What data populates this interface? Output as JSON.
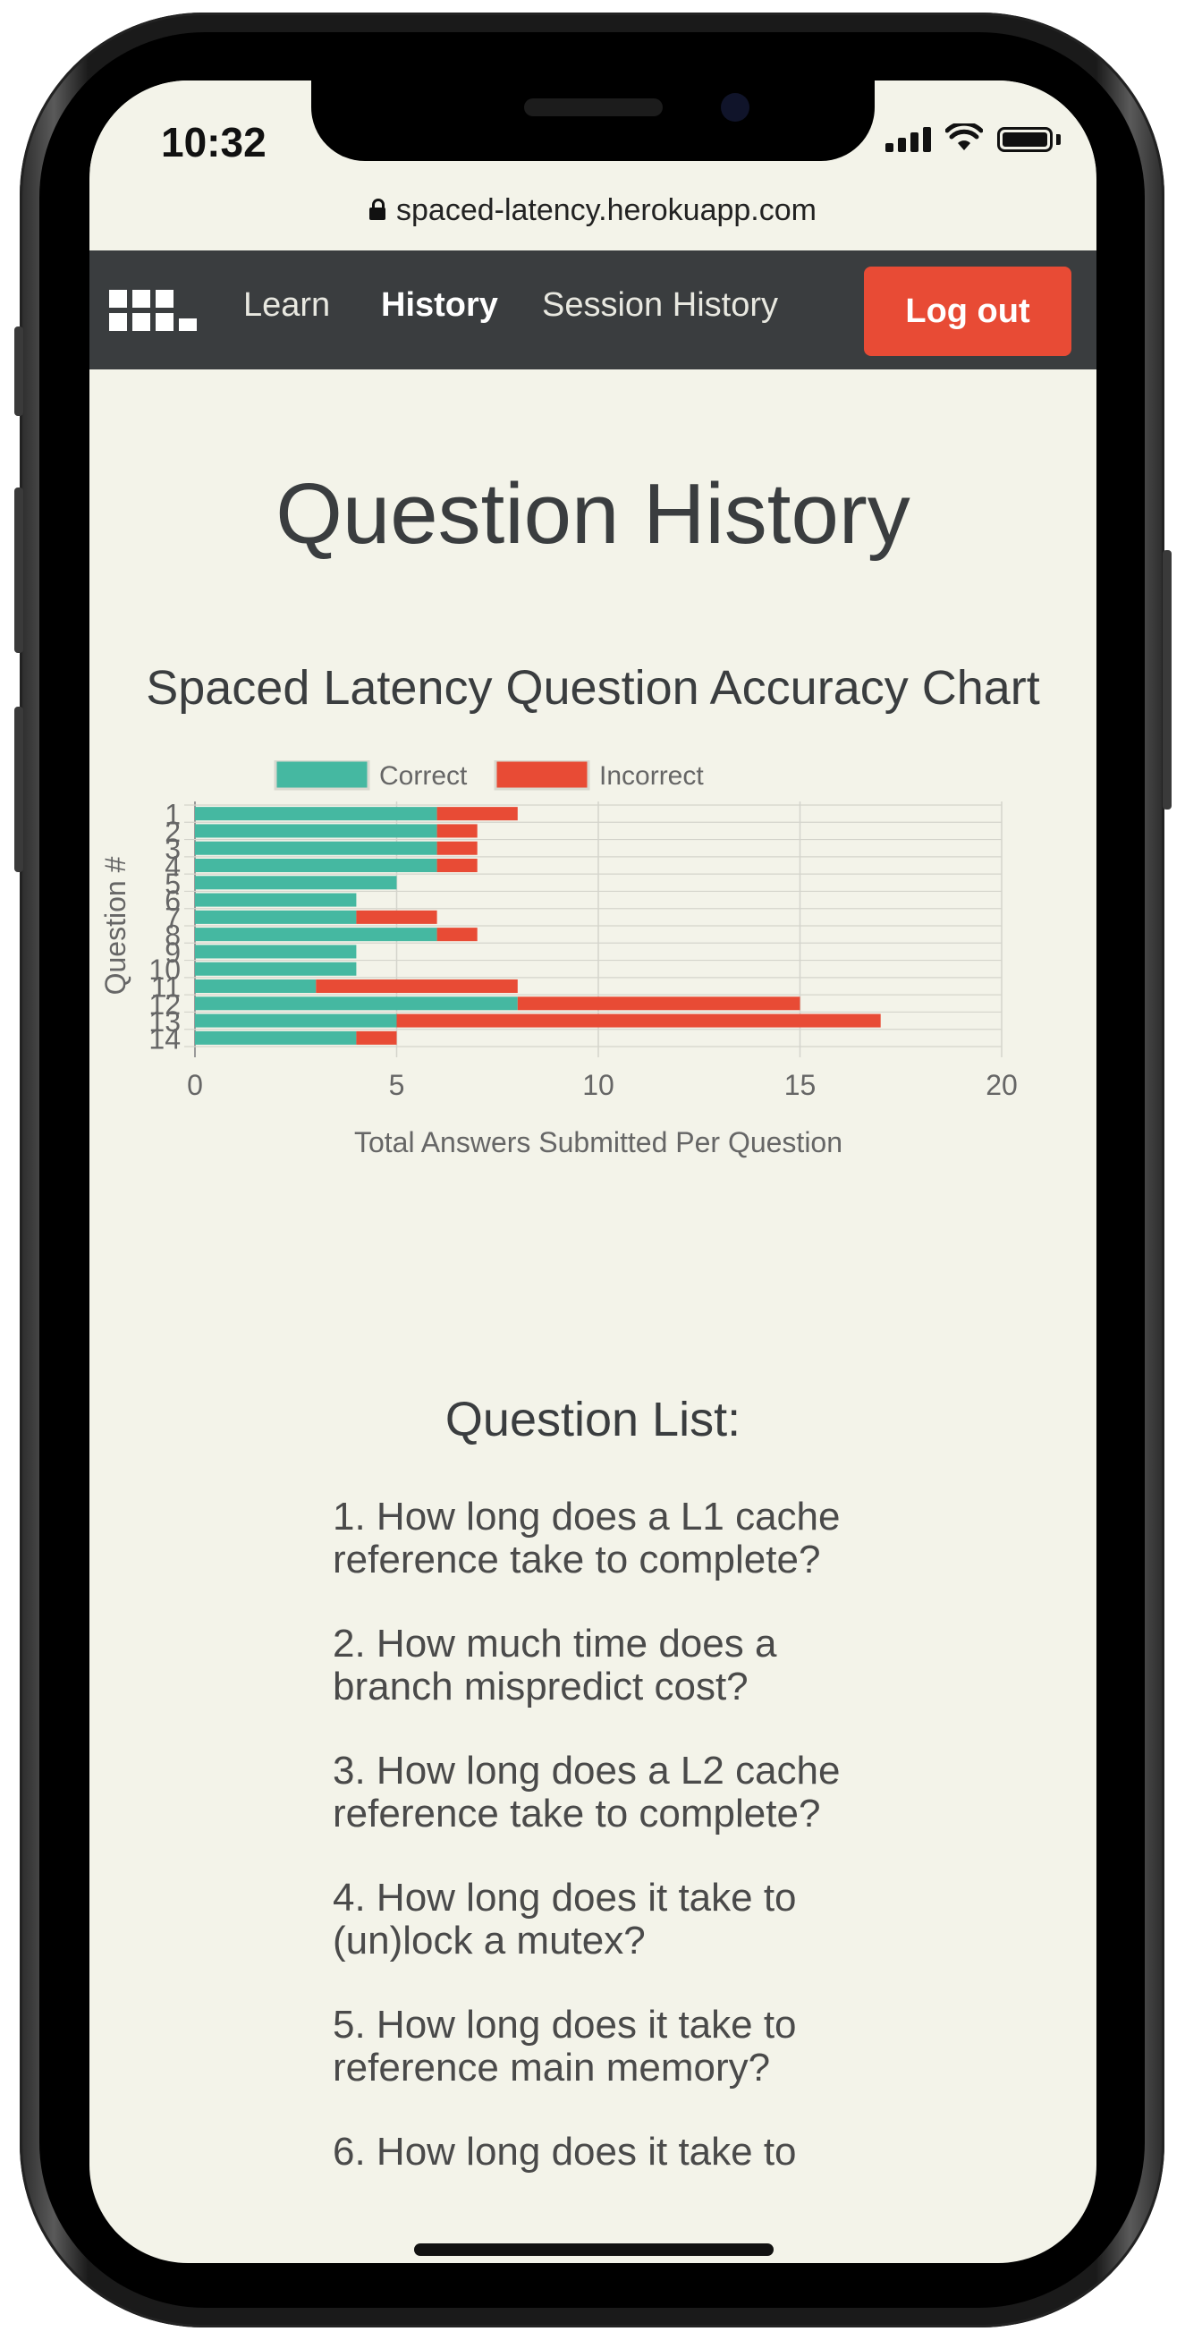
{
  "status_bar": {
    "time": "10:32"
  },
  "browser": {
    "url": "spaced-latency.herokuapp.com"
  },
  "nav": {
    "items": [
      "Learn",
      "History",
      "Session History"
    ],
    "active": "History",
    "logout_label": "Log out"
  },
  "page": {
    "title": "Question History",
    "chart_title": "Spaced Latency Question Accuracy Chart",
    "list_title": "Question List:"
  },
  "questions": [
    "1. How long does a L1 cache reference take to complete?",
    "2. How much time does a branch mispredict cost?",
    "3. How long does a L2 cache reference take to complete?",
    "4. How long does it take to (un)lock a mutex?",
    "5. How long does it take to reference main memory?",
    "6. How long does it take to"
  ],
  "colors": {
    "correct": "#45b8a1",
    "incorrect": "#e84b35",
    "nav": "#3a3d3f",
    "background": "#f3f3e9"
  },
  "chart_data": {
    "type": "bar",
    "orientation": "horizontal",
    "stacked": true,
    "categories": [
      "1",
      "2",
      "3",
      "4",
      "5",
      "6",
      "7",
      "8",
      "9",
      "10",
      "11",
      "12",
      "13",
      "14"
    ],
    "series": [
      {
        "name": "Correct",
        "values": [
          6,
          6,
          6,
          6,
          5,
          4,
          4,
          6,
          4,
          4,
          3,
          8,
          5,
          4
        ]
      },
      {
        "name": "Incorrect",
        "values": [
          2,
          1,
          1,
          1,
          0,
          0,
          2,
          1,
          0,
          0,
          5,
          7,
          12,
          1
        ]
      }
    ],
    "xlabel": "Total Answers Submitted Per Question",
    "ylabel": "Question #",
    "xlim": [
      0,
      20
    ],
    "xticks": [
      "0",
      "5",
      "10",
      "15",
      "20"
    ],
    "grid": true,
    "legend": "top-center"
  }
}
